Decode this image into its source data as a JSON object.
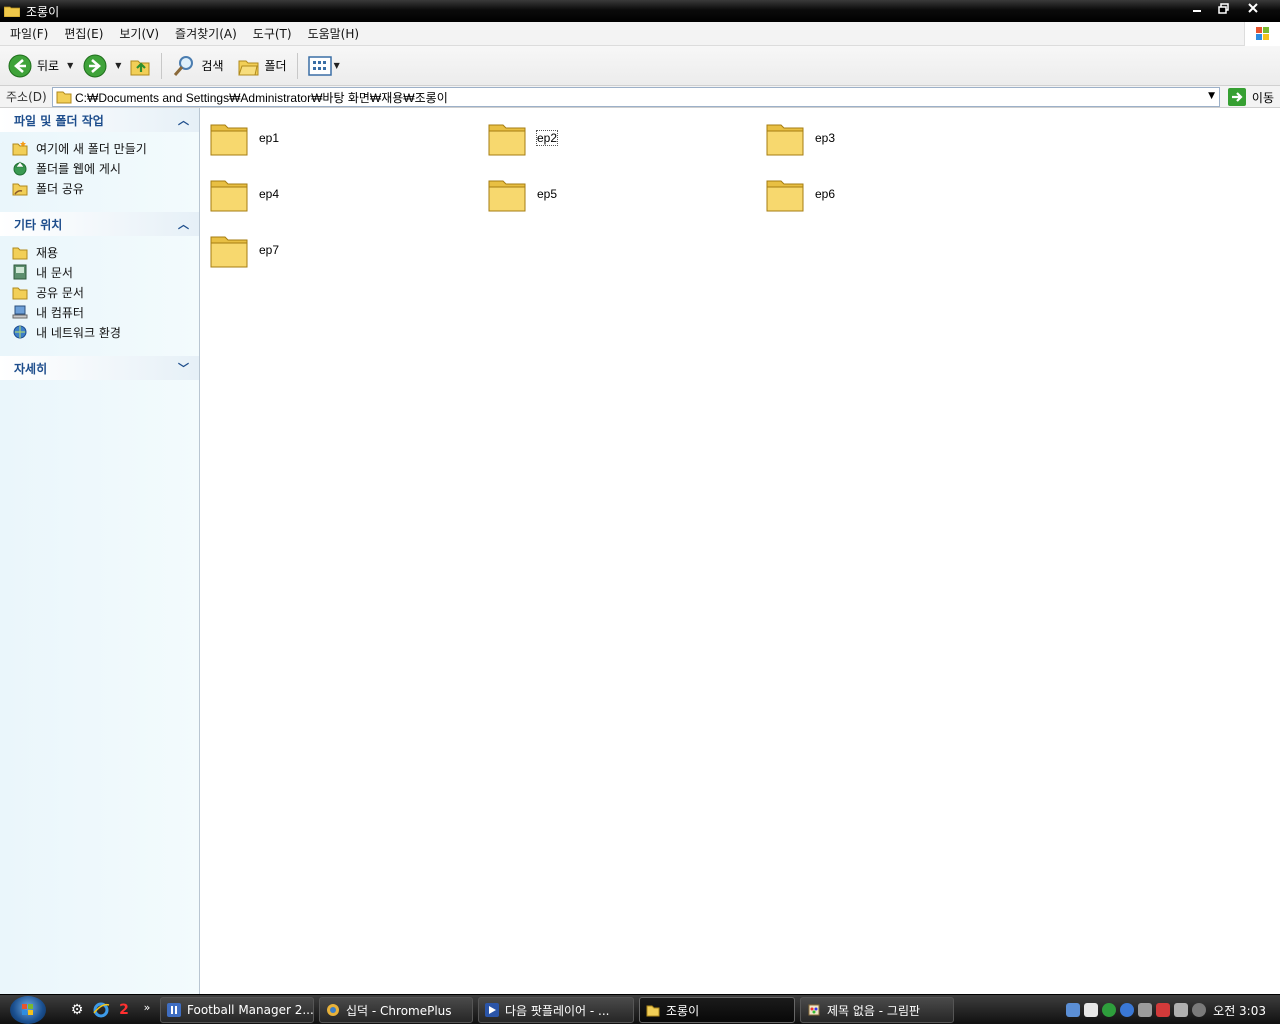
{
  "window": {
    "title": "조롱이"
  },
  "menu": [
    "파일(F)",
    "편집(E)",
    "보기(V)",
    "즐겨찾기(A)",
    "도구(T)",
    "도움말(H)"
  ],
  "toolbar": {
    "back_label": "뒤로",
    "search_label": "검색",
    "folders_label": "폴더"
  },
  "address": {
    "label": "주소(D)",
    "value": "C:₩Documents and Settings₩Administrator₩바탕 화면₩재용₩조롱이",
    "go_label": "이동"
  },
  "tasks": {
    "file_folder": {
      "title": "파일 및 폴더 작업",
      "items": [
        "여기에 새 폴더 만들기",
        "폴더를 웹에 게시",
        "폴더 공유"
      ]
    },
    "other_places": {
      "title": "기타 위치",
      "items": [
        "재용",
        "내 문서",
        "공유 문서",
        "내 컴퓨터",
        "내 네트워크 환경"
      ]
    },
    "details": {
      "title": "자세히"
    }
  },
  "folders": [
    "ep1",
    "ep2",
    "ep3",
    "ep4",
    "ep5",
    "ep6",
    "ep7"
  ],
  "selected_folder": "ep2",
  "taskbar": {
    "quicklaunch_badge": "2",
    "buttons": [
      "Football Manager 2...",
      "십덕 - ChromePlus",
      "다음 팟플레이어 - ...",
      "조롱이",
      "제목 없음 - 그림판"
    ],
    "active_button": "조롱이",
    "clock": "오전 3:03"
  },
  "colors": {
    "task_header_text": "#1d4d8c",
    "folder_yellow": "#f5d35a",
    "titlebar": "#0b0b0b"
  }
}
